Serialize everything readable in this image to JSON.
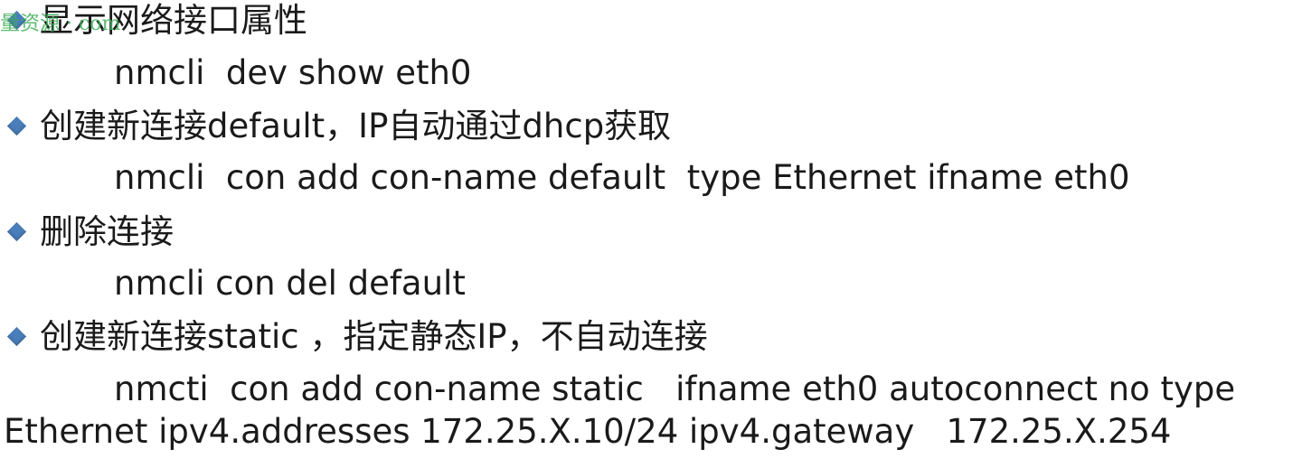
{
  "watermark": "量资源 · com",
  "sections": [
    {
      "heading": "显示网络接口属性",
      "commands": [
        "nmcli  dev show eth0"
      ]
    },
    {
      "heading": "创建新连接default，IP自动通过dhcp获取",
      "commands": [
        "nmcli  con add con-name default  type Ethernet ifname eth0"
      ]
    },
    {
      "heading": "删除连接",
      "commands": [
        "nmcli con del default"
      ]
    },
    {
      "heading": "创建新连接static ，指定静态IP，不自动连接",
      "commands": [
        "nmcti  con add con-name static   ifname eth0 autoconnect no type",
        "Ethernet ipv4.addresses 172.25.X.10/24 ipv4.gateway   172.25.X.254"
      ]
    }
  ],
  "colors": {
    "bullet": "#4a7ebb",
    "text": "#1a1a1a",
    "watermark": "#3fae5a",
    "background": "#ffffff"
  },
  "icons": {
    "bullet": "diamond-bullet-icon"
  }
}
